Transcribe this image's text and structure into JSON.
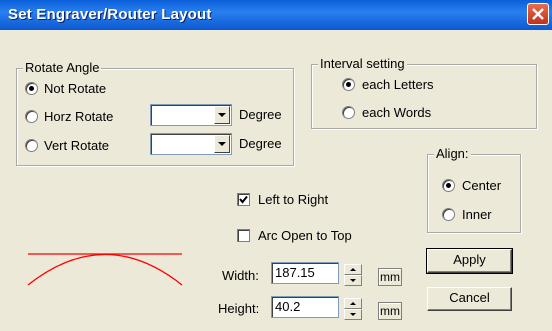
{
  "window": {
    "title": "Set Engraver/Router Layout"
  },
  "rotate": {
    "legend": "Rotate Angle",
    "options": [
      {
        "label": "Not Rotate",
        "selected": true
      },
      {
        "label": "Horz Rotate",
        "selected": false
      },
      {
        "label": "Vert Rotate",
        "selected": false
      }
    ],
    "horz_unit": "Degree",
    "vert_unit": "Degree",
    "horz_value": "",
    "vert_value": ""
  },
  "interval": {
    "legend": "Interval setting",
    "options": [
      {
        "label": "each Letters",
        "selected": true
      },
      {
        "label": "each Words",
        "selected": false
      }
    ]
  },
  "align": {
    "legend": "Align:",
    "options": [
      {
        "label": "Center",
        "selected": true
      },
      {
        "label": "Inner",
        "selected": false
      }
    ]
  },
  "options": {
    "left_to_right": {
      "label": "Left to Right",
      "checked": true
    },
    "arc_open_top": {
      "label": "Arc Open to Top",
      "checked": false
    }
  },
  "size": {
    "width_label": "Width:",
    "width_value": "187.15",
    "height_label": "Height:",
    "height_value": "40.2",
    "unit": "mm"
  },
  "buttons": {
    "apply": "Apply",
    "cancel": "Cancel"
  },
  "preview": {
    "arc_color": "#ff0000"
  },
  "colors": {
    "titlebar": "#0b58d0",
    "close": "#c3301a",
    "face": "#ece9d8"
  }
}
